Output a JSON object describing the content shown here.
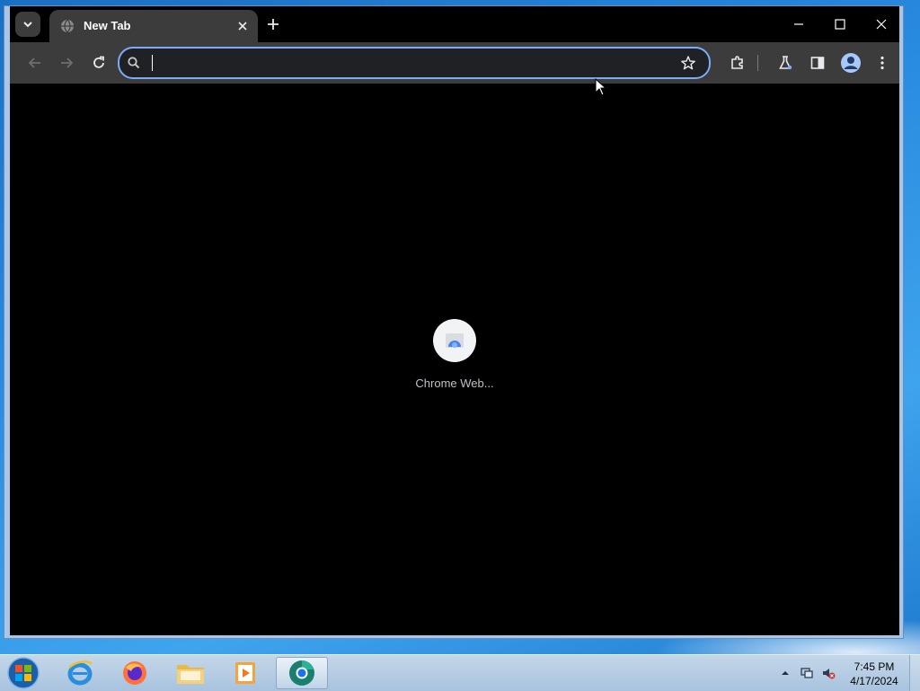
{
  "browser": {
    "tab": {
      "title": "New Tab",
      "favicon": "globe-icon"
    },
    "window_controls": [
      "minimize-icon",
      "maximize-icon",
      "close-icon"
    ],
    "omnibox": {
      "value": "",
      "placeholder": ""
    },
    "toolbar_icons": [
      "back-arrow-icon",
      "forward-arrow-icon",
      "reload-icon",
      "star-icon",
      "extensions-icon",
      "labs-flask-icon",
      "side-panel-icon",
      "profile-icon",
      "more-menu-icon"
    ],
    "accent_color": "#7cacf8"
  },
  "new_tab_page": {
    "shortcuts": [
      {
        "label": "Chrome Web..."
      }
    ]
  },
  "taskbar": {
    "apps": [
      "internet-explorer-icon",
      "firefox-icon",
      "file-explorer-icon",
      "media-player-icon",
      "chrome-beta-icon"
    ],
    "clock": {
      "time": "7:45 PM",
      "date": "4/17/2024"
    }
  }
}
